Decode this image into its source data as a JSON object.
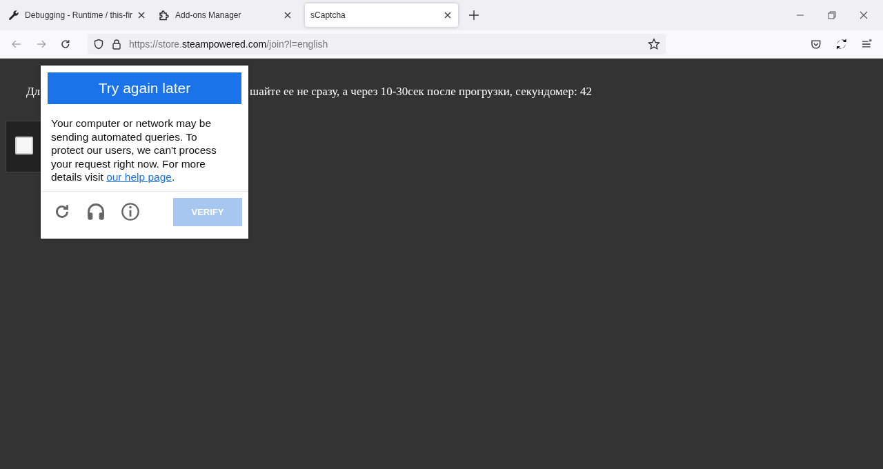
{
  "tabs": [
    {
      "label": "Debugging - Runtime / this-fir",
      "kind": "wrench",
      "selected": false
    },
    {
      "label": "Add-ons Manager",
      "kind": "puzzle",
      "selected": false
    },
    {
      "label": "sCaptcha",
      "kind": "plain",
      "selected": true
    }
  ],
  "address_bar": {
    "url_prefix": "https://store.",
    "url_domain": "steampowered.com",
    "url_suffix": "/join?l=english"
  },
  "page": {
    "text_left": "Дл",
    "text_right": "шайте ее не сразу, а через 10-30сек после прогрузки, секундомер: 42",
    "checkbox": {
      "checked": false
    }
  },
  "captcha_popup": {
    "title": "Try again later",
    "message": "Your computer or network may be sending automated queries. To protect our users, we can't process your request right now. For more details visit ",
    "link": "our help page",
    "message_end": ".",
    "verify_button": {
      "label": "VERIFY",
      "disabled": true
    }
  }
}
